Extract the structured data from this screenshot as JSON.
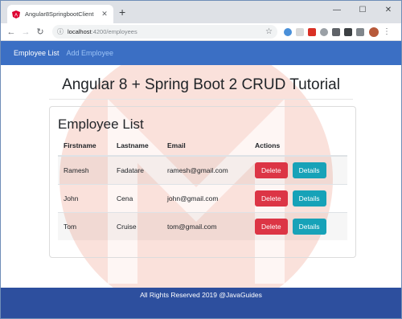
{
  "browser": {
    "tab_title": "Angular8SpringbootClient",
    "url_host": "localhost",
    "url_path": ":4200/employees"
  },
  "app": {
    "nav": {
      "brand": "Employee List",
      "add_link": "Add Employee"
    },
    "heading": "Angular 8 + Spring Boot 2 CRUD Tutorial",
    "card_title": "Employee List",
    "table": {
      "headers": [
        "Firstname",
        "Lastname",
        "Email",
        "Actions"
      ],
      "rows": [
        {
          "firstname": "Ramesh",
          "lastname": "Fadatare",
          "email": "ramesh@gmail.com"
        },
        {
          "firstname": "John",
          "lastname": "Cena",
          "email": "john@gmail.com"
        },
        {
          "firstname": "Tom",
          "lastname": "Cruise",
          "email": "tom@gmail.com"
        }
      ],
      "delete_label": "Delete",
      "details_label": "Details"
    },
    "footer": "All Rights Reserved 2019 @JavaGuides"
  },
  "colors": {
    "navbar": "#3b6fc4",
    "footer": "#2d4f9e",
    "danger": "#dc3545",
    "info": "#17a2b8",
    "watermark": "#f6c9bd"
  }
}
